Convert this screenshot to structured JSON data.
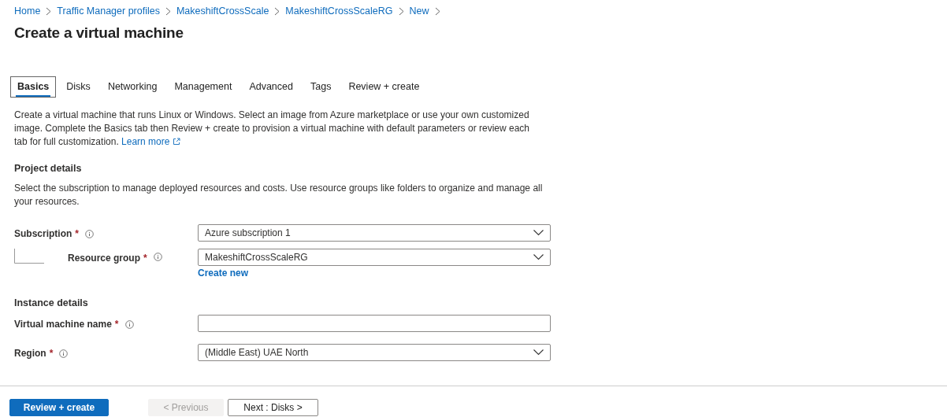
{
  "breadcrumb": [
    {
      "label": "Home"
    },
    {
      "label": "Traffic Manager profiles"
    },
    {
      "label": "MakeshiftCrossScale"
    },
    {
      "label": "MakeshiftCrossScaleRG"
    },
    {
      "label": "New"
    }
  ],
  "title": "Create a virtual machine",
  "tabs": [
    {
      "label": "Basics",
      "selected": true
    },
    {
      "label": "Disks",
      "selected": false
    },
    {
      "label": "Networking",
      "selected": false
    },
    {
      "label": "Management",
      "selected": false
    },
    {
      "label": "Advanced",
      "selected": false
    },
    {
      "label": "Tags",
      "selected": false
    },
    {
      "label": "Review + create",
      "selected": false
    }
  ],
  "intro": {
    "text": "Create a virtual machine that runs Linux or Windows. Select an image from Azure marketplace or use your own customized image. Complete the Basics tab then Review + create to provision a virtual machine with default parameters or review each tab for full customization.",
    "link": "Learn more"
  },
  "sections": [
    {
      "heading": "Project details",
      "description": "Select the subscription to manage deployed resources and costs. Use resource groups like folders to organize and manage all your resources.",
      "fields": [
        {
          "label": "Subscription",
          "required_mark": "*",
          "kind": "dropdown",
          "value": "Azure subscription 1",
          "children": [
            {
              "label": "Resource group",
              "required_mark": "*",
              "kind": "dropdown",
              "value": "MakeshiftCrossScaleRG",
              "link": "Create new"
            }
          ]
        }
      ]
    },
    {
      "heading": "Instance details",
      "fields": [
        {
          "label": "Virtual machine name",
          "required_mark": "*",
          "kind": "text"
        },
        {
          "label": "Region",
          "required_mark": "*",
          "kind": "dropdown",
          "value": "(Middle East) UAE North"
        }
      ]
    }
  ],
  "footer": [
    {
      "label": "Review + create",
      "kind": "primary",
      "disabled": false
    },
    {
      "label": "< Previous",
      "kind": "secondary",
      "disabled": true
    },
    {
      "label": "Next : Disks >",
      "kind": "secondary",
      "disabled": false
    }
  ]
}
